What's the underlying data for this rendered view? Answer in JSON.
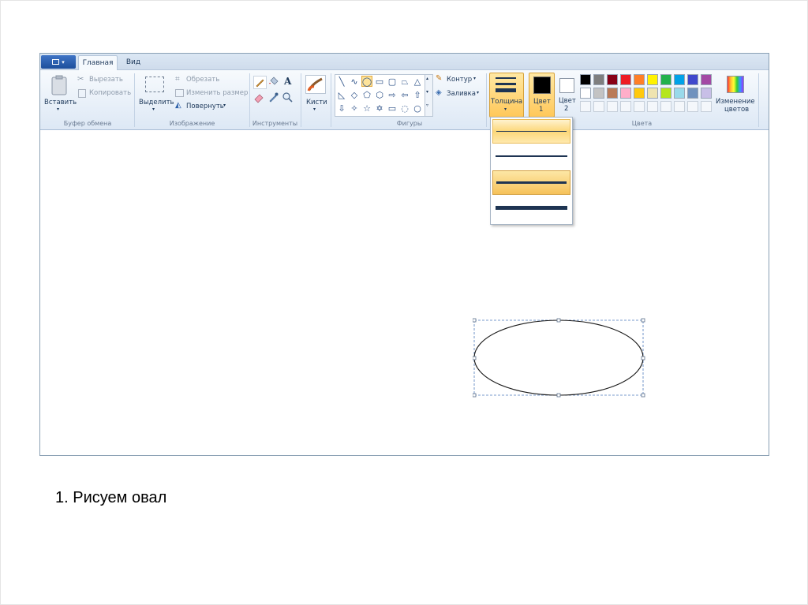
{
  "tabs": {
    "home": "Главная",
    "view": "Вид"
  },
  "clipboard": {
    "paste": "Вставить",
    "cut": "Вырезать",
    "copy": "Копировать",
    "group": "Буфер обмена"
  },
  "image": {
    "select": "Выделить",
    "crop": "Обрезать",
    "resize": "Изменить размер",
    "rotate": "Повернуть",
    "group": "Изображение"
  },
  "tools": {
    "group": "Инструменты",
    "brushes": "Кисти"
  },
  "shapes": {
    "group": "Фигуры",
    "outline": "Контур",
    "fill": "Заливка"
  },
  "size": {
    "label": "Толщина"
  },
  "colors": {
    "color1_line1": "Цвет",
    "color1_line2": "1",
    "color2_line1": "Цвет",
    "color2_line2": "2",
    "group": "Цвета",
    "edit_line1": "Изменение",
    "edit_line2": "цветов",
    "palette_row1": [
      "#000000",
      "#7f7f7f",
      "#880015",
      "#ed1c24",
      "#ff7f27",
      "#fff200",
      "#22b14c",
      "#00a2e8",
      "#3f48cc",
      "#a349a4"
    ],
    "palette_row2": [
      "#ffffff",
      "#c3c3c3",
      "#b97a57",
      "#ffaec9",
      "#ffc90e",
      "#efe4b0",
      "#b5e61d",
      "#99d9ea",
      "#7092be",
      "#c8bfe7"
    ],
    "color1_value": "#000000",
    "color2_value": "#ffffff"
  },
  "size_options": [
    "1px",
    "3px",
    "5px",
    "8px"
  ],
  "size_selected_index": 2,
  "caption": "1. Рисуем овал"
}
